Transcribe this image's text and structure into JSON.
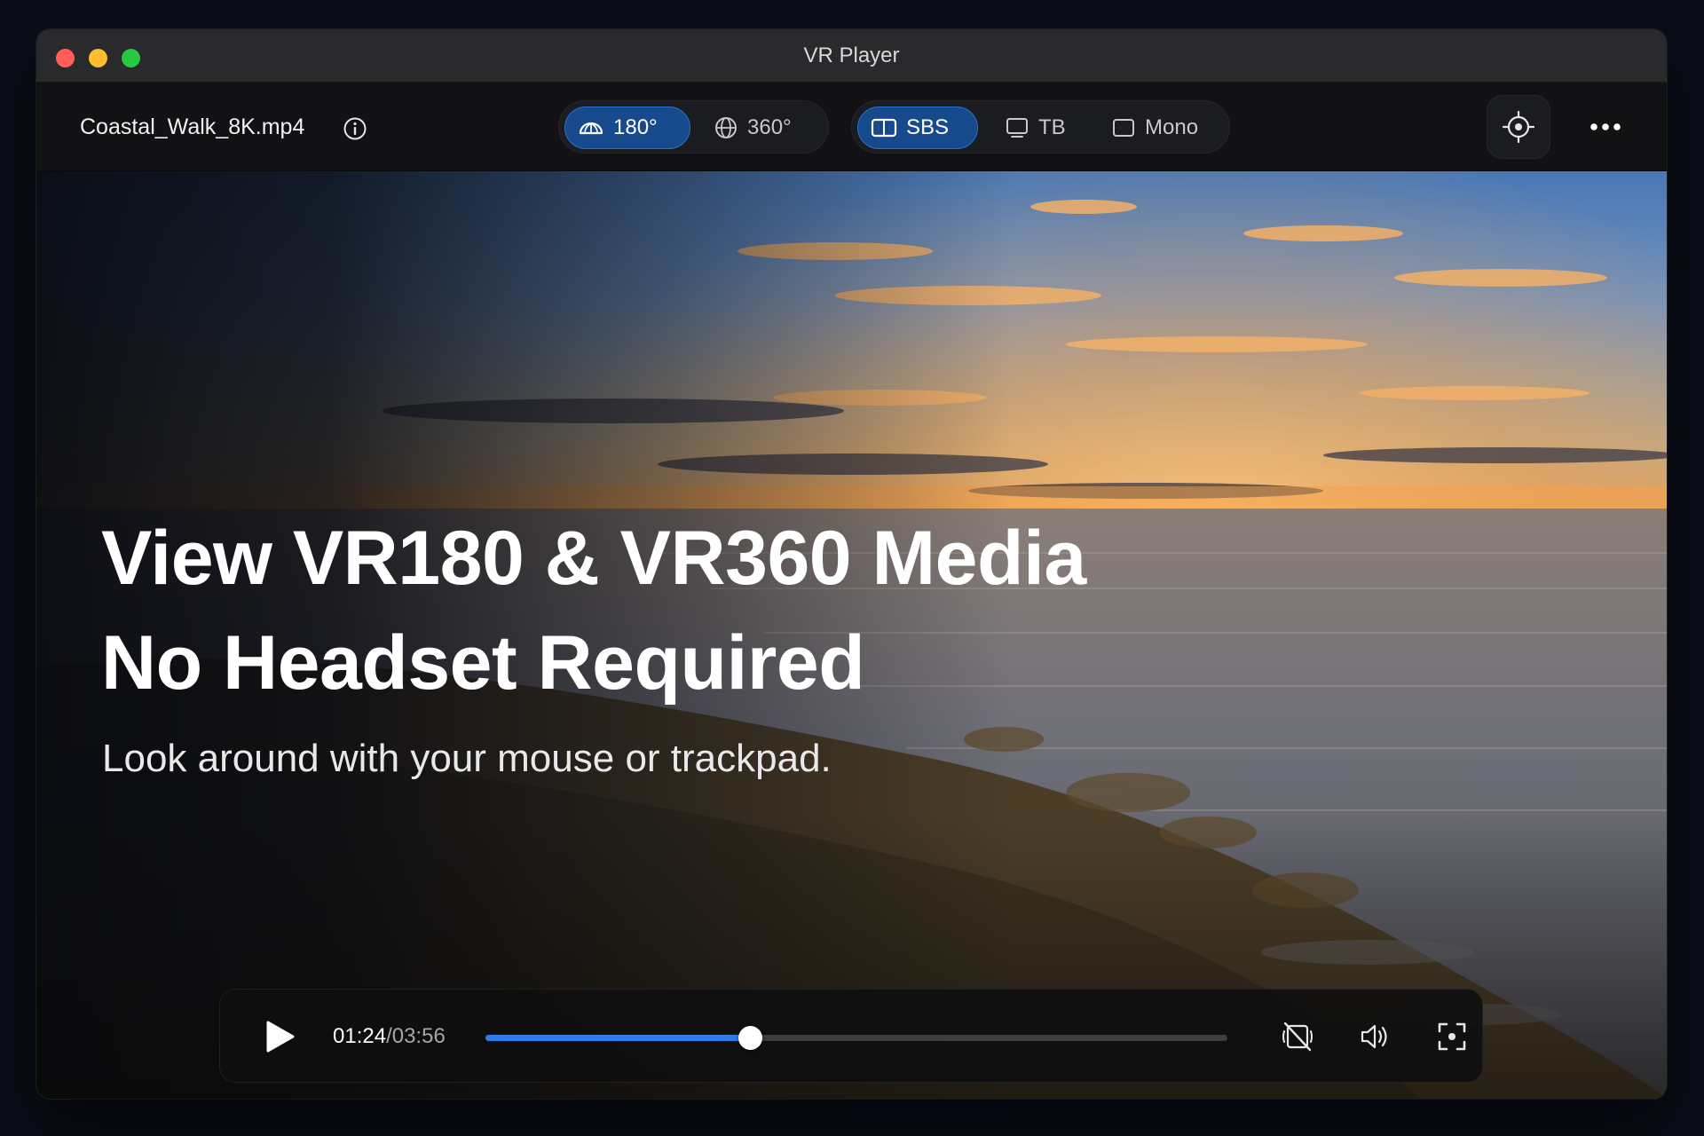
{
  "window": {
    "title": "VR Player"
  },
  "toolbar": {
    "file_name": "Coastal_Walk_8K.mp4",
    "projection": [
      {
        "label": "180°",
        "icon": "hemisphere-icon",
        "active": true
      },
      {
        "label": "360°",
        "icon": "globe-icon",
        "active": false
      }
    ],
    "layout": [
      {
        "label": "SBS",
        "icon": "side-by-side-icon",
        "active": true
      },
      {
        "label": "TB",
        "icon": "top-bottom-icon",
        "active": false
      },
      {
        "label": "Mono",
        "icon": "mono-icon",
        "active": false
      }
    ],
    "accent_color": "#174a8c"
  },
  "hero": {
    "line1": "View VR180 & VR360 Media",
    "line2": "No Headset Required",
    "subtitle": "Look around with your mouse or trackpad."
  },
  "player": {
    "current_time": "01:24",
    "separator": "/",
    "duration": "03:56",
    "progress": 0.356,
    "progress_color": "#2e7ae6"
  }
}
